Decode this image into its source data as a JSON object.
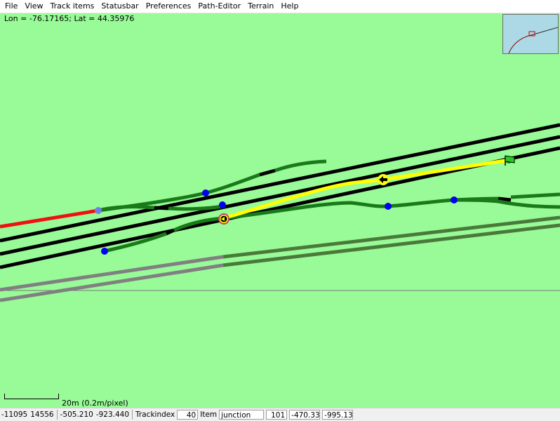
{
  "menu": {
    "items": [
      {
        "label": "File"
      },
      {
        "label": "View"
      },
      {
        "label": "Track items"
      },
      {
        "label": "Statusbar"
      },
      {
        "label": "Preferences"
      },
      {
        "label": "Path-Editor"
      },
      {
        "label": "Terrain"
      },
      {
        "label": "Help"
      }
    ]
  },
  "map": {
    "coordinates": "Lon = -76.17165; Lat = 44.35976",
    "scale_label": "20m (0.2m/pixel)",
    "colors": {
      "terrain": "#98fb98",
      "track": "#000000",
      "path_track": "#1a7a1a",
      "selected_path": "#ffff00",
      "out_of_area_track": "#ee1111",
      "road_near": "#808080",
      "road_far": "#4a7a3a",
      "junction_marker": "#0000ee",
      "path_start_marker": "#7080e0",
      "minimap_water": "#add8e6",
      "tile_boundary": "#787878"
    },
    "markers": [
      {
        "name": "junction-marker",
        "color": "#0000ee"
      },
      {
        "name": "junction-marker",
        "color": "#0000ee"
      },
      {
        "name": "junction-marker",
        "color": "#0000ee"
      },
      {
        "name": "junction-marker",
        "color": "#0000ee"
      },
      {
        "name": "junction-marker",
        "color": "#0000ee"
      },
      {
        "name": "path-start-marker",
        "color": "#7080e0"
      }
    ],
    "icons": {
      "path_end": "green-flag-icon",
      "direction": "direction-arrow-icon",
      "wait_point": "circle-arrow-icon"
    }
  },
  "statusbar": {
    "tile_x": "-11095",
    "tile_z": "14556",
    "x": "-505.210",
    "z": "-923.440",
    "trackindex_label": "Trackindex",
    "trackindex_value": "40",
    "item_label": "Item",
    "item_value": "junction",
    "item_index": "101",
    "item_x": "-470.336",
    "item_z": "-995.130"
  }
}
